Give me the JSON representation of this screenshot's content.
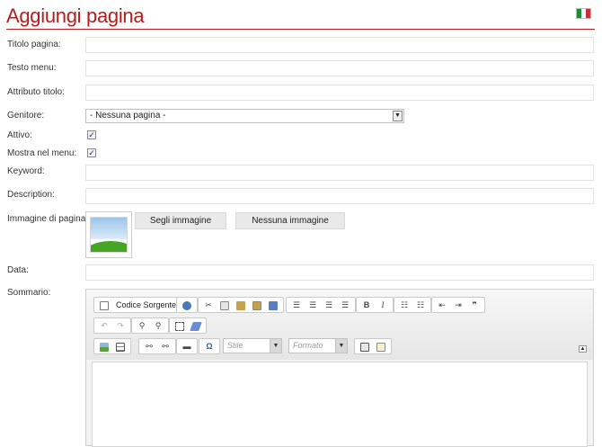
{
  "page": {
    "title": "Aggiungi pagina"
  },
  "fields": {
    "titolo_pagina": {
      "label": "Titolo pagina:",
      "value": ""
    },
    "testo_menu": {
      "label": "Testo menu:",
      "value": ""
    },
    "attributo_titolo": {
      "label": "Attributo titolo:",
      "value": ""
    },
    "genitore": {
      "label": "Genitore:",
      "selected": "- Nessuna pagina -"
    },
    "attivo": {
      "label": "Attivo:",
      "checked": true
    },
    "mostra_nel_menu": {
      "label": "Mostra nel menu:",
      "checked": true
    },
    "keyword": {
      "label": "Keyword:",
      "value": ""
    },
    "description": {
      "label": "Description:",
      "value": ""
    },
    "immagine": {
      "label": "Immagine di pagina:",
      "choose_label": "Segli immagine",
      "none_label": "Nessuna immagine"
    },
    "data": {
      "label": "Data:",
      "value": ""
    },
    "sommario": {
      "label": "Sommario:"
    }
  },
  "editor": {
    "source_label": "Codice Sorgente",
    "style_placeholder": "Stile",
    "format_placeholder": "Formato",
    "toolbar_icons": {
      "row1": [
        "source-icon",
        "preview-icon",
        "cut-icon",
        "copy-icon",
        "paste-icon",
        "paste-text-icon",
        "paste-word-icon",
        "align-left-icon",
        "align-center-icon",
        "align-right-icon",
        "justify-icon",
        "bold-icon",
        "italic-icon",
        "numbered-list-icon",
        "bulleted-list-icon",
        "outdent-icon",
        "indent-icon",
        "blockquote-icon"
      ],
      "row2": [
        "undo-icon",
        "redo-icon",
        "find-icon",
        "replace-icon",
        "select-all-icon",
        "remove-format-icon"
      ],
      "row3": [
        "image-icon",
        "table-icon",
        "link-icon",
        "unlink-icon",
        "horizontal-rule-icon",
        "special-char-icon",
        "maximize-icon",
        "show-blocks-icon"
      ]
    }
  },
  "colors": {
    "accent": "#b81d1d"
  }
}
